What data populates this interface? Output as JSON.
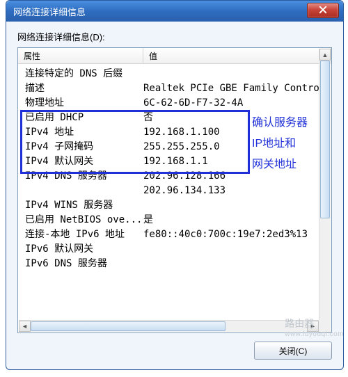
{
  "dialog": {
    "title": "网络连接详细信息",
    "detail_label": "网络连接详细信息(D):",
    "columns": {
      "property": "属性",
      "value": "值"
    },
    "close_button": "关闭(C)"
  },
  "rows": [
    {
      "prop": "连接特定的 DNS 后缀",
      "val": ""
    },
    {
      "prop": "描述",
      "val": "Realtek PCIe GBE Family Contro"
    },
    {
      "prop": "物理地址",
      "val": "6C-62-6D-F7-32-4A"
    },
    {
      "prop": "已启用 DHCP",
      "val": "否"
    },
    {
      "prop": "IPv4 地址",
      "val": "192.168.1.100"
    },
    {
      "prop": "IPv4 子网掩码",
      "val": "255.255.255.0"
    },
    {
      "prop": "IPv4 默认网关",
      "val": "192.168.1.1"
    },
    {
      "prop": "IPv4 DNS 服务器",
      "val": "202.96.128.166"
    },
    {
      "prop": "",
      "val": "202.96.134.133"
    },
    {
      "prop": "IPv4 WINS 服务器",
      "val": ""
    },
    {
      "prop": "已启用 NetBIOS ove...",
      "val": "是"
    },
    {
      "prop": "连接-本地 IPv6 地址",
      "val": "fe80::40c0:700c:19e7:2ed3%13"
    },
    {
      "prop": "IPv6 默认网关",
      "val": ""
    },
    {
      "prop": "IPv6 DNS 服务器",
      "val": ""
    }
  ],
  "annotations": {
    "line1": "确认服务器",
    "line2": "IP地址和",
    "line3": "网关地址"
  },
  "watermark": {
    "main": "路由器",
    "sub": "www.luyouqi.com"
  }
}
